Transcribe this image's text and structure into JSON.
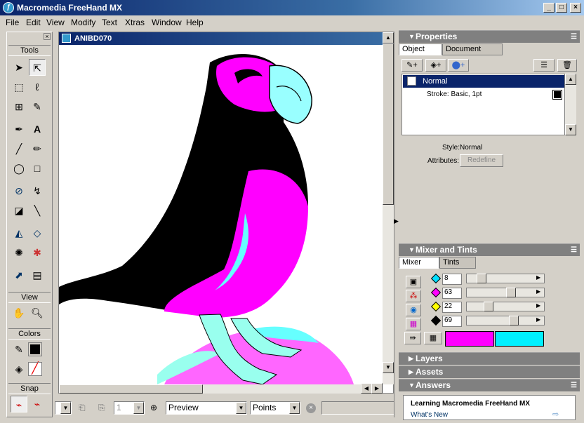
{
  "window": {
    "title": "Macromedia FreeHand MX",
    "icon": "freehand-app-icon"
  },
  "menu": [
    "File",
    "Edit",
    "View",
    "Modify",
    "Text",
    "Xtras",
    "Window",
    "Help"
  ],
  "toolbox": {
    "tools_label": "Tools",
    "view_label": "View",
    "colors_label": "Colors",
    "snap_label": "Snap"
  },
  "document": {
    "title": "ANIBD070"
  },
  "status": {
    "page_number": "1",
    "view_mode": "Preview",
    "units": "Points"
  },
  "properties": {
    "title": "Properties",
    "tabs": [
      "Object",
      "Document"
    ],
    "list": {
      "item": "Normal",
      "stroke": "Stroke: Basic, 1pt"
    },
    "style_label": "Style:",
    "style_value": "Normal",
    "attributes_label": "Attributes:",
    "redefine_label": "Redefine"
  },
  "mixer": {
    "title": "Mixer and Tints",
    "tabs": [
      "Mixer",
      "Tints"
    ],
    "channels": [
      {
        "name": "cyan",
        "value": "8",
        "color": "#00e0ff"
      },
      {
        "name": "magenta",
        "value": "63",
        "color": "#ff00ff"
      },
      {
        "name": "yellow",
        "value": "22",
        "color": "#ffff00"
      },
      {
        "name": "black",
        "value": "69",
        "color": "#000000"
      }
    ],
    "swatch_colors": [
      "#ff00ff",
      "#00f0ff"
    ]
  },
  "layers_title": "Layers",
  "assets_title": "Assets",
  "answers": {
    "title": "Answers",
    "heading": "Learning Macromedia FreeHand MX",
    "link": "What's New"
  }
}
